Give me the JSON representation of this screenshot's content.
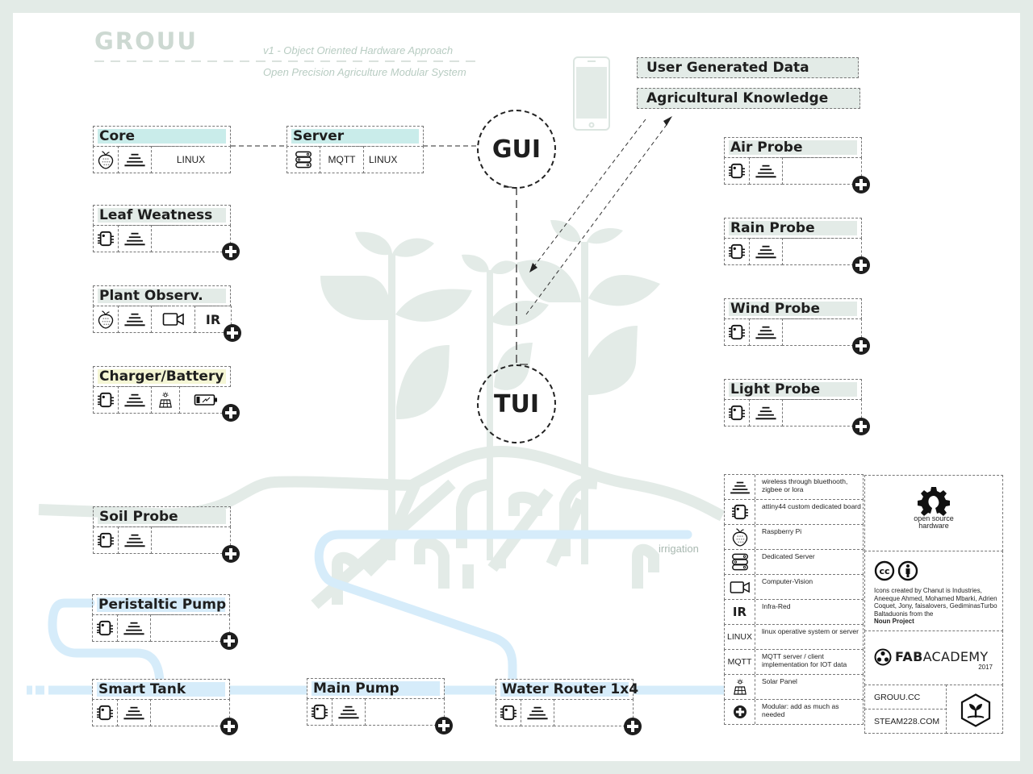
{
  "header": {
    "logo": "GROUU",
    "subtitle_1": "v1 - Object Oriented Hardware Approach",
    "subtitle_2": "Open Precision Agriculture Modular System"
  },
  "interfaces": {
    "gui": "GUI",
    "tui": "TUI"
  },
  "knowledge": {
    "user_data": "User Generated Data",
    "agri_knowledge": "Agricultural Knowledge"
  },
  "colors": {
    "teal_fill": "#c9ecea",
    "grey_fill": "#e3ebe7",
    "yellow_fill": "#f5f6d4",
    "blue_fill": "#d6ecfa",
    "plant": "#e3ebe7",
    "water": "#d6ecfa"
  },
  "modules": {
    "core": {
      "title": "Core",
      "cells": [
        "raspberry-pi",
        "wireless",
        "LINUX"
      ]
    },
    "server": {
      "title": "Server",
      "cells": [
        "server",
        "MQTT",
        "LINUX"
      ]
    },
    "leaf": {
      "title": "Leaf Weatness",
      "cells": [
        "attiny",
        "wireless",
        ""
      ]
    },
    "plant_obs": {
      "title": "Plant Observ.",
      "cells": [
        "raspberry-pi",
        "wireless",
        "camera",
        "IR"
      ]
    },
    "charger": {
      "title": "Charger/Battery",
      "cells": [
        "attiny",
        "wireless",
        "solar",
        "battery"
      ]
    },
    "soil": {
      "title": "Soil Probe",
      "cells": [
        "attiny",
        "wireless",
        ""
      ]
    },
    "peristaltic": {
      "title": "Peristaltic Pump",
      "cells": [
        "attiny",
        "wireless",
        ""
      ]
    },
    "tank": {
      "title": "Smart Tank",
      "cells": [
        "attiny",
        "wireless",
        ""
      ]
    },
    "main_pump": {
      "title": "Main Pump",
      "cells": [
        "attiny",
        "wireless",
        ""
      ]
    },
    "router": {
      "title": "Water Router 1x4",
      "cells": [
        "attiny",
        "wireless",
        ""
      ]
    },
    "air": {
      "title": "Air Probe",
      "cells": [
        "attiny",
        "wireless",
        ""
      ]
    },
    "rain": {
      "title": "Rain Probe",
      "cells": [
        "attiny",
        "wireless",
        ""
      ]
    },
    "wind": {
      "title": "Wind Probe",
      "cells": [
        "attiny",
        "wireless",
        ""
      ]
    },
    "light": {
      "title": "Light Probe",
      "cells": [
        "attiny",
        "wireless",
        ""
      ]
    }
  },
  "irrigation_label": "irrigation",
  "legend": [
    {
      "icon": "wireless-icon",
      "text": "wireless through bluethooth, zigbee or lora"
    },
    {
      "icon": "attiny-board-icon",
      "text": "attiny44 custom dedicated board"
    },
    {
      "icon": "raspberry-pi-icon",
      "text": "Raspberry Pi"
    },
    {
      "icon": "server-icon",
      "text": "Dedicated Server"
    },
    {
      "icon": "camera-icon",
      "text": "Computer-Vision"
    },
    {
      "icon": "IR",
      "text": "Infra-Red"
    },
    {
      "icon": "LINUX",
      "text": "linux operative system or server"
    },
    {
      "icon": "MQTT",
      "text": "MQTT server / client implementation for IOT data"
    },
    {
      "icon": "solar-panel-icon",
      "text": "Solar Panel"
    },
    {
      "icon": "plus-icon",
      "text": "Modular: add as much as needed"
    }
  ],
  "credits": {
    "osh_line1": "open source",
    "osh_line2": "hardware",
    "icons_credit": "Icons created by Chanut is Industries, Aneeque Ahmed, Mohamed Mbarki, Adrien Coquet, Jony, faisalovers, GediminasTurbo Baltaduonis from the",
    "noun_project": "Noun Project",
    "fab_bold": "FAB",
    "fab_rest": "ACADEMY",
    "fab_year": "2017",
    "link_1": "GROUU.CC",
    "link_2": "STEAM228.COM"
  }
}
